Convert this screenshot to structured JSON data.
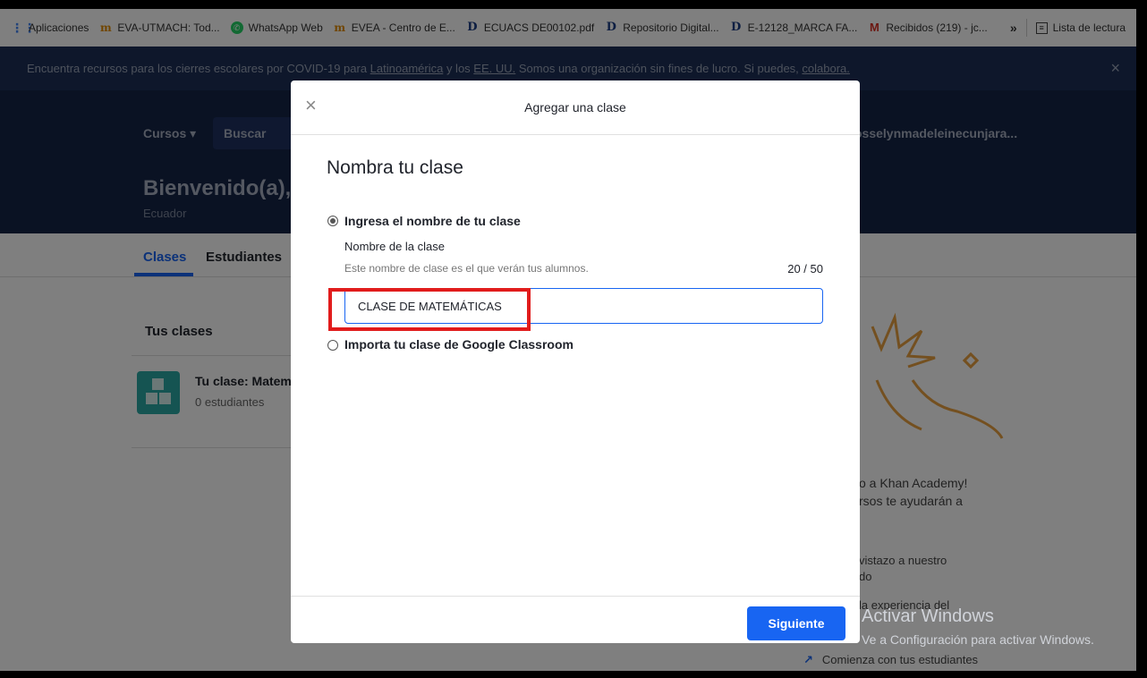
{
  "bookmarks": {
    "items": [
      {
        "icon": "apps-grid-icon",
        "label": "Aplicaciones"
      },
      {
        "icon": "khan-icon",
        "label": "EVA-UTMACH: Tod..."
      },
      {
        "icon": "whatsapp-icon",
        "label": "WhatsApp Web"
      },
      {
        "icon": "khan-icon",
        "label": "EVEA - Centro de E..."
      },
      {
        "icon": "docs-d-icon",
        "label": "ECUACS DE00102.pdf"
      },
      {
        "icon": "docs-d-icon",
        "label": "Repositorio Digital..."
      },
      {
        "icon": "docs-d-icon",
        "label": "E-12128_MARCA FA..."
      },
      {
        "icon": "gmail-icon",
        "label": "Recibidos (219) - jc..."
      }
    ],
    "more": "»",
    "reading_list": "Lista de lectura"
  },
  "announcement": {
    "text_before": "Encuentra recursos para los cierres escolares por COVID-19 para ",
    "link1": "Latinoamérica",
    "text_mid": " y los ",
    "link2": "EE. UU.",
    "text_after": " Somos una organización sin fines de lucro. Si puedes, ",
    "link3": "colabora.",
    "close": "×"
  },
  "nav": {
    "courses": "Cursos ▾",
    "search": "Buscar",
    "user": "osselynmadeleinecunjara..."
  },
  "header": {
    "welcome": "Bienvenido(a), josse",
    "country": "Ecuador"
  },
  "tabs": {
    "clases": "Clases",
    "estudiantes": "Estudiantes"
  },
  "classes": {
    "title": "Tus clases",
    "item_name": "Tu clase: Matemá",
    "item_count": "0 estudiantes"
  },
  "side_card": {
    "line1": "o a Khan Academy!",
    "line2": "rsos te ayudarán a",
    "line3": "vistazo a nuestro",
    "line4": "do",
    "line5": "la experiencia del",
    "line6": "Comienza con tus estudiantes"
  },
  "modal": {
    "close": "×",
    "title": "Agregar una clase",
    "heading": "Nombra tu clase",
    "option_name": "Ingresa el nombre de tu clase",
    "field_label": "Nombre de la clase",
    "field_hint": "Este nombre de clase es el que verán tus alumnos.",
    "char_count": "20 / 50",
    "input_value": "CLASE DE MATEMÁTICAS",
    "option_google": "Importa tu clase de Google Classroom",
    "next": "Siguiente"
  },
  "watermark": {
    "title": "Activar Windows",
    "subtitle": "Ve a Configuración para activar Windows."
  }
}
